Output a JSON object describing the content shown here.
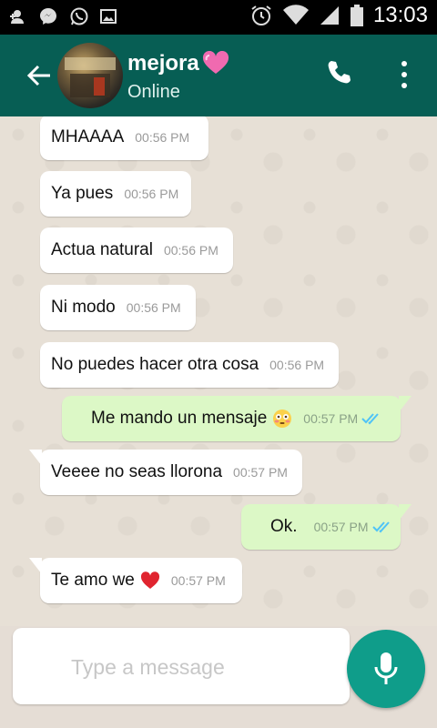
{
  "status_bar": {
    "time": "13:03"
  },
  "header": {
    "contact_name": "mejora",
    "status": "Online"
  },
  "messages": [
    {
      "direction": "in",
      "text": "MHAAAA",
      "time": "00:56 PM"
    },
    {
      "direction": "in",
      "text": "Ya pues",
      "time": "00:56 PM"
    },
    {
      "direction": "in",
      "text": "Actua natural",
      "time": "00:56 PM"
    },
    {
      "direction": "in",
      "text": "Ni modo",
      "time": "00:56 PM"
    },
    {
      "direction": "in",
      "text": "No puedes hacer otra cosa",
      "time": "00:56 PM"
    },
    {
      "direction": "out",
      "text": "Me mando un mensaje",
      "time": "00:57 PM",
      "emoji": "flushed-face"
    },
    {
      "direction": "in",
      "text": "Veeee no seas llorona",
      "time": "00:57 PM"
    },
    {
      "direction": "out",
      "text": "Ok.",
      "time": "00:57 PM"
    },
    {
      "direction": "in",
      "text": "Te amo we",
      "time": "00:57 PM",
      "emoji": "red-heart"
    }
  ],
  "composer": {
    "placeholder": "Type a message"
  },
  "colors": {
    "header": "#075e54",
    "incoming_bubble": "#ffffff",
    "outgoing_bubble": "#dcf8c6",
    "read_ticks": "#4fc3f7",
    "mic_button": "#0f9d8a"
  }
}
